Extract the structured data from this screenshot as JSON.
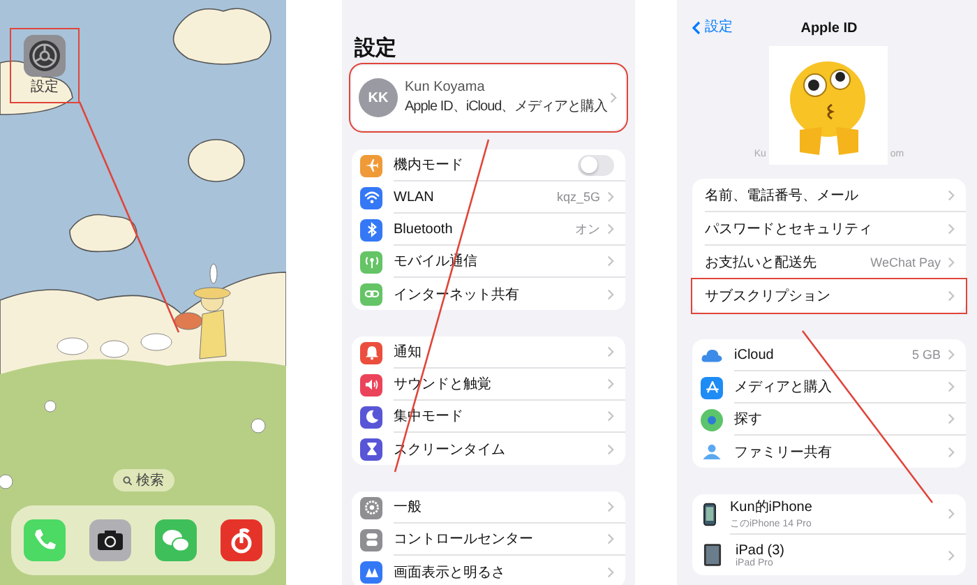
{
  "home_screen": {
    "settings_app": {
      "label": "設定",
      "highlighted": true
    },
    "search_pill": {
      "label": "検索"
    },
    "dock": [
      {
        "kind": "phone"
      },
      {
        "kind": "camera"
      },
      {
        "kind": "chat"
      },
      {
        "kind": "music"
      }
    ]
  },
  "settings": {
    "title": "設定",
    "profile": {
      "initials": "KK",
      "name": "Kun Koyama",
      "subtitle": "Apple ID、iCloud、メディアと購入",
      "highlighted": true
    },
    "groups": [
      {
        "items": [
          {
            "kind": "toggle",
            "color": "#f09a37",
            "label": "機内モード",
            "on": false
          },
          {
            "kind": "link",
            "color": "#3478f6",
            "label": "WLAN",
            "value": "kqz_5G"
          },
          {
            "kind": "link",
            "color": "#3478f6",
            "label": "Bluetooth",
            "value": "オン"
          },
          {
            "kind": "link",
            "color": "#65c466",
            "label": "モバイル通信"
          },
          {
            "kind": "link",
            "color": "#65c466",
            "label": "インターネット共有"
          }
        ]
      },
      {
        "items": [
          {
            "kind": "link",
            "color": "#eb4e3d",
            "label": "通知"
          },
          {
            "kind": "link",
            "color": "#eb445a",
            "label": "サウンドと触覚"
          },
          {
            "kind": "link",
            "color": "#5856d6",
            "label": "集中モード"
          },
          {
            "kind": "link",
            "color": "#5856d6",
            "label": "スクリーンタイム"
          }
        ]
      },
      {
        "items": [
          {
            "kind": "link",
            "color": "#8e8e93",
            "label": "一般"
          },
          {
            "kind": "link",
            "color": "#8e8e93",
            "label": "コントロールセンター"
          },
          {
            "kind": "link",
            "color": "#3478f6",
            "label": "画面表示と明るさ"
          }
        ]
      }
    ]
  },
  "apple_id": {
    "back_label": "設定",
    "title": "Apple ID",
    "email_visible_parts": [
      "Ku",
      "om"
    ],
    "account_rows": [
      {
        "label": "名前、電話番号、メール",
        "highlighted": false
      },
      {
        "label": "パスワードとセキュリティ",
        "highlighted": false
      },
      {
        "label": "お支払いと配送先",
        "value": "WeChat Pay",
        "highlighted": false
      },
      {
        "label": "サブスクリプション",
        "highlighted": true
      }
    ],
    "service_rows": [
      {
        "label": "iCloud",
        "value": "5 GB"
      },
      {
        "label": "メディアと購入"
      },
      {
        "label": "探す"
      },
      {
        "label": "ファミリー共有"
      }
    ],
    "devices": [
      {
        "name": "Kun的iPhone",
        "model": "このiPhone 14 Pro"
      },
      {
        "name": "iPad (3)",
        "model": "iPad Pro"
      }
    ]
  }
}
